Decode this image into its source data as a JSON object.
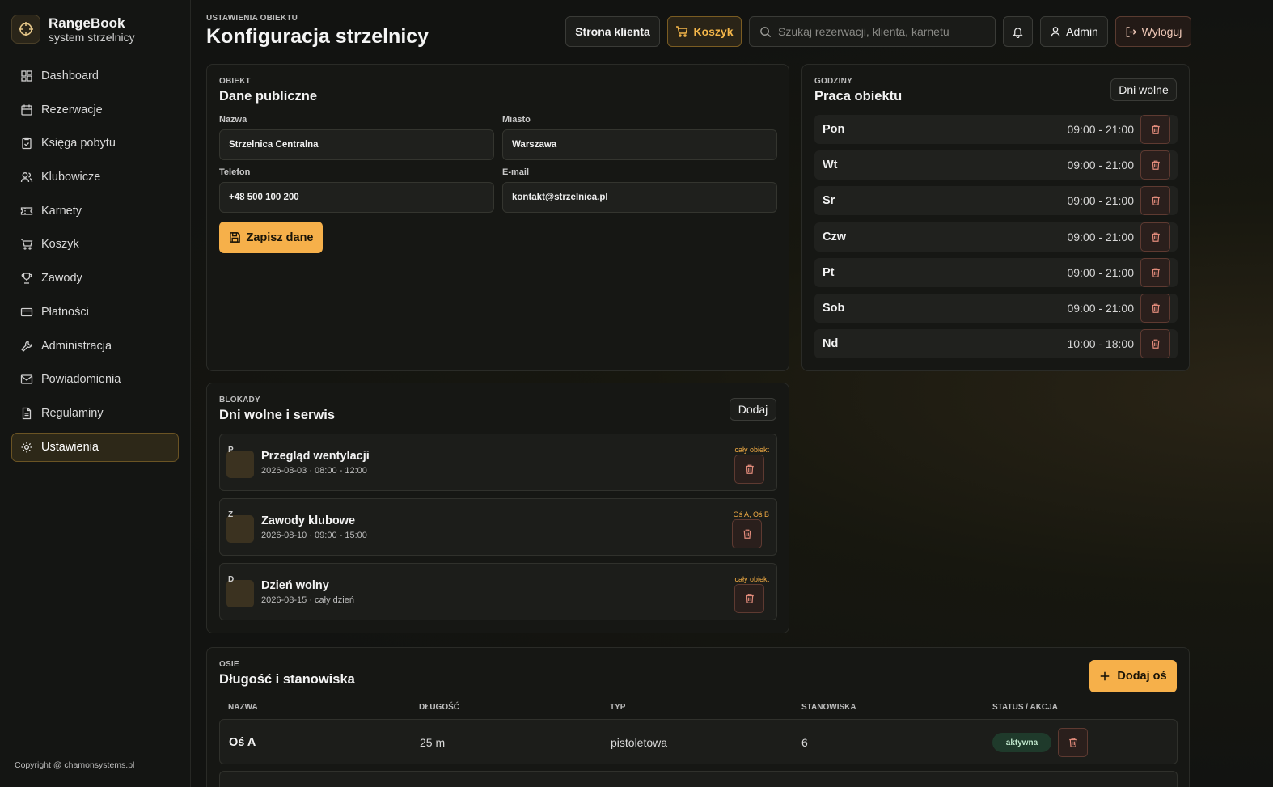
{
  "brand": {
    "name": "RangeBook",
    "subtitle": "system strzelnicy"
  },
  "nav": [
    {
      "label": "Dashboard",
      "icon": "dashboard-icon"
    },
    {
      "label": "Rezerwacje",
      "icon": "calendar-icon"
    },
    {
      "label": "Księga pobytu",
      "icon": "clipboard-icon"
    },
    {
      "label": "Klubowicze",
      "icon": "users-icon"
    },
    {
      "label": "Karnety",
      "icon": "ticket-icon"
    },
    {
      "label": "Koszyk",
      "icon": "cart-icon"
    },
    {
      "label": "Zawody",
      "icon": "trophy-icon"
    },
    {
      "label": "Płatności",
      "icon": "card-icon"
    },
    {
      "label": "Administracja",
      "icon": "wrench-icon"
    },
    {
      "label": "Powiadomienia",
      "icon": "mail-icon"
    },
    {
      "label": "Regulaminy",
      "icon": "document-icon"
    },
    {
      "label": "Ustawienia",
      "icon": "gear-icon",
      "active": true
    }
  ],
  "copyright": "Copyright @ chamonsystems.pl",
  "header": {
    "eyebrow": "USTAWIENIA OBIEKTU",
    "title": "Konfiguracja strzelnicy",
    "client_button": "Strona klienta",
    "cart_button": "Koszyk",
    "search_placeholder": "Szukaj rezerwacji, klienta, karnetu",
    "admin_button": "Admin",
    "logout_button": "Wyloguj"
  },
  "public_data": {
    "eyebrow": "OBIEKT",
    "title": "Dane publiczne",
    "fields": {
      "name": {
        "label": "Nazwa",
        "value": "Strzelnica Centralna"
      },
      "city": {
        "label": "Miasto",
        "value": "Warszawa"
      },
      "phone": {
        "label": "Telefon",
        "value": "+48 500 100 200"
      },
      "email": {
        "label": "E-mail",
        "value": "kontakt@strzelnica.pl"
      }
    },
    "save_button": "Zapisz dane"
  },
  "hours": {
    "eyebrow": "GODZINY",
    "title": "Praca obiektu",
    "days_off_button": "Dni wolne",
    "rows": [
      {
        "day": "Pon",
        "time": "09:00 - 21:00"
      },
      {
        "day": "Wt",
        "time": "09:00 - 21:00"
      },
      {
        "day": "Sr",
        "time": "09:00 - 21:00"
      },
      {
        "day": "Czw",
        "time": "09:00 - 21:00"
      },
      {
        "day": "Pt",
        "time": "09:00 - 21:00"
      },
      {
        "day": "Sob",
        "time": "09:00 - 21:00"
      },
      {
        "day": "Nd",
        "time": "10:00 - 18:00"
      }
    ]
  },
  "blocks": {
    "eyebrow": "BLOKADY",
    "title": "Dni wolne i serwis",
    "add_button": "Dodaj",
    "items": [
      {
        "letter": "P",
        "title": "Przegląd wentylacji",
        "sub": "2026-08-03 · 08:00 - 12:00",
        "scope": "cały obiekt"
      },
      {
        "letter": "Z",
        "title": "Zawody klubowe",
        "sub": "2026-08-10 · 09:00 - 15:00",
        "scope": "Oś A, Oś B"
      },
      {
        "letter": "D",
        "title": "Dzień wolny",
        "sub": "2026-08-15 · cały dzień",
        "scope": "cały obiekt"
      }
    ]
  },
  "axes": {
    "eyebrow": "OSIE",
    "title": "Długość i stanowiska",
    "add_button": "Dodaj oś",
    "columns": [
      "NAZWA",
      "DŁUGOŚĆ",
      "TYP",
      "STANOWISKA",
      "STATUS / AKCJA"
    ],
    "rows": [
      {
        "name": "Oś A",
        "length": "25 m",
        "type": "pistoletowa",
        "stations": "6",
        "status": "aktywna"
      }
    ]
  },
  "colors": {
    "accent": "#f6b04a",
    "danger": "#e08a7a",
    "success": "#1f3a2b"
  }
}
